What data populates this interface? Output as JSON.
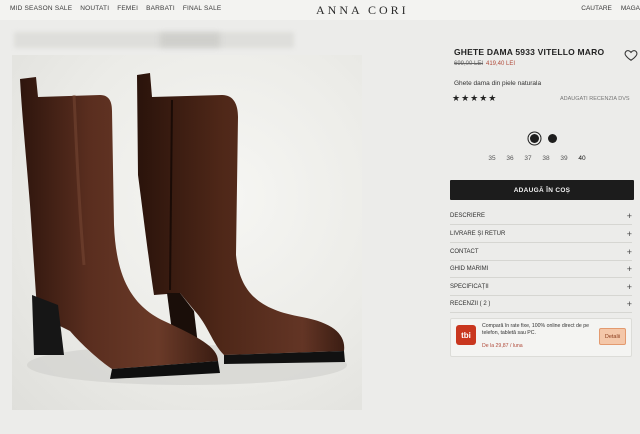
{
  "nav": {
    "left": [
      "MID SEASON SALE",
      "NOUTATI",
      "FEMEI",
      "BARBATI",
      "FINAL SALE"
    ],
    "brand": "ANNA CORI",
    "right": [
      "CAUTARE",
      "MAGA"
    ]
  },
  "product": {
    "title": "GHETE DAMA 5933 VITELLO MARO",
    "old_price": "699,00 LEI",
    "new_price": "419,40 LEI",
    "description": "Ghete dama din piele naturala",
    "stars": "★★★★★",
    "review_link": "ADAUGATI RECENZIA DVS",
    "colors": [
      "#1e1e1e",
      "#1e1e1e"
    ],
    "sizes": [
      "35",
      "36",
      "37",
      "38",
      "39",
      "40"
    ],
    "add_to_cart": "ADAUGĂ ÎN COȘ"
  },
  "accordion": [
    {
      "label": "DESCRIERE"
    },
    {
      "label": "LIVRARE ȘI RETUR"
    },
    {
      "label": "CONTACT"
    },
    {
      "label": "GHID MARIMI"
    },
    {
      "label": "SPECIFICAȚII"
    },
    {
      "label": "RECENZII ( 2 )"
    }
  ],
  "accordion_icon": "+",
  "financing": {
    "logo": "tbi",
    "text": "Compară în rate fixe, 100% online direct de pe telefon, tabletă sau PC.",
    "rate": "De la 29,87 / luna",
    "button": "Detalii",
    "brand_color": "#c9371f"
  },
  "colors": {
    "accent_dark": "#1c1c1c",
    "sale_red": "#b04a3a",
    "boot_brown": "#4a2518"
  }
}
